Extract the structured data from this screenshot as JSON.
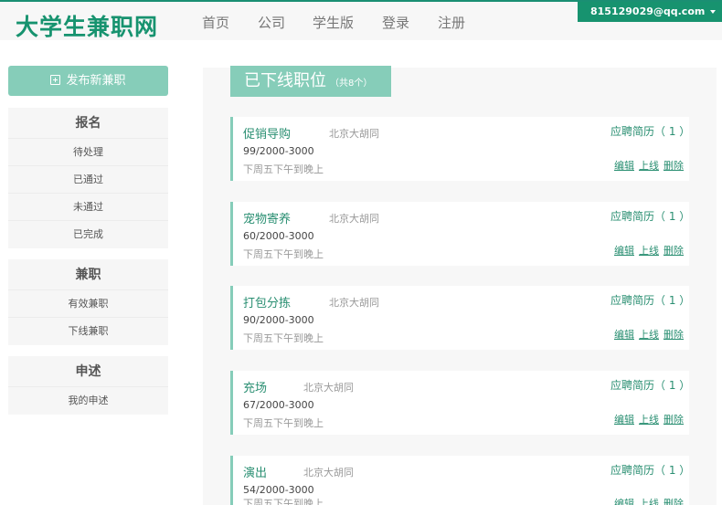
{
  "header": {
    "logo": "大学生兼职网",
    "nav": [
      "首页",
      "公司",
      "学生版",
      "登录",
      "注册"
    ],
    "account": "815129029@qq.com"
  },
  "sidebar": {
    "publish_label": "发布新兼职",
    "groups": [
      {
        "title": "报名",
        "items": [
          "待处理",
          "已通过",
          "未通过",
          "已完成"
        ]
      },
      {
        "title": "兼职",
        "items": [
          "有效兼职",
          "下线兼职"
        ]
      },
      {
        "title": "申述",
        "items": [
          "我的申述"
        ]
      }
    ]
  },
  "main": {
    "title": "已下线职位",
    "count": "（共8个）",
    "jobs": [
      {
        "name": "促销导购",
        "location": "北京大胡同",
        "pay": "99/2000-3000",
        "time": "下周五下午到晚上",
        "resume": "应聘简历（ 1 ）",
        "actions": [
          "编辑",
          "上线",
          "删除"
        ]
      },
      {
        "name": "宠物寄养",
        "location": "北京大胡同",
        "pay": "60/2000-3000",
        "time": "下周五下午到晚上",
        "resume": "应聘简历（ 1 ）",
        "actions": [
          "编辑",
          "上线",
          "删除"
        ]
      },
      {
        "name": "打包分拣",
        "location": "北京大胡同",
        "pay": "90/2000-3000",
        "time": "下周五下午到晚上",
        "resume": "应聘简历（ 1 ）",
        "actions": [
          "编辑",
          "上线",
          "删除"
        ]
      },
      {
        "name": "充场",
        "location": "北京大胡同",
        "pay": "67/2000-3000",
        "time": "下周五下午到晚上",
        "resume": "应聘简历（ 1 ）",
        "actions": [
          "编辑",
          "上线",
          "删除"
        ]
      },
      {
        "name": "演出",
        "location": "北京大胡同",
        "pay": "54/2000-3000",
        "time": "下周五下午到晚上",
        "resume": "应聘简历（ 1 ）",
        "actions": [
          "编辑",
          "上线",
          "删除"
        ]
      }
    ]
  }
}
